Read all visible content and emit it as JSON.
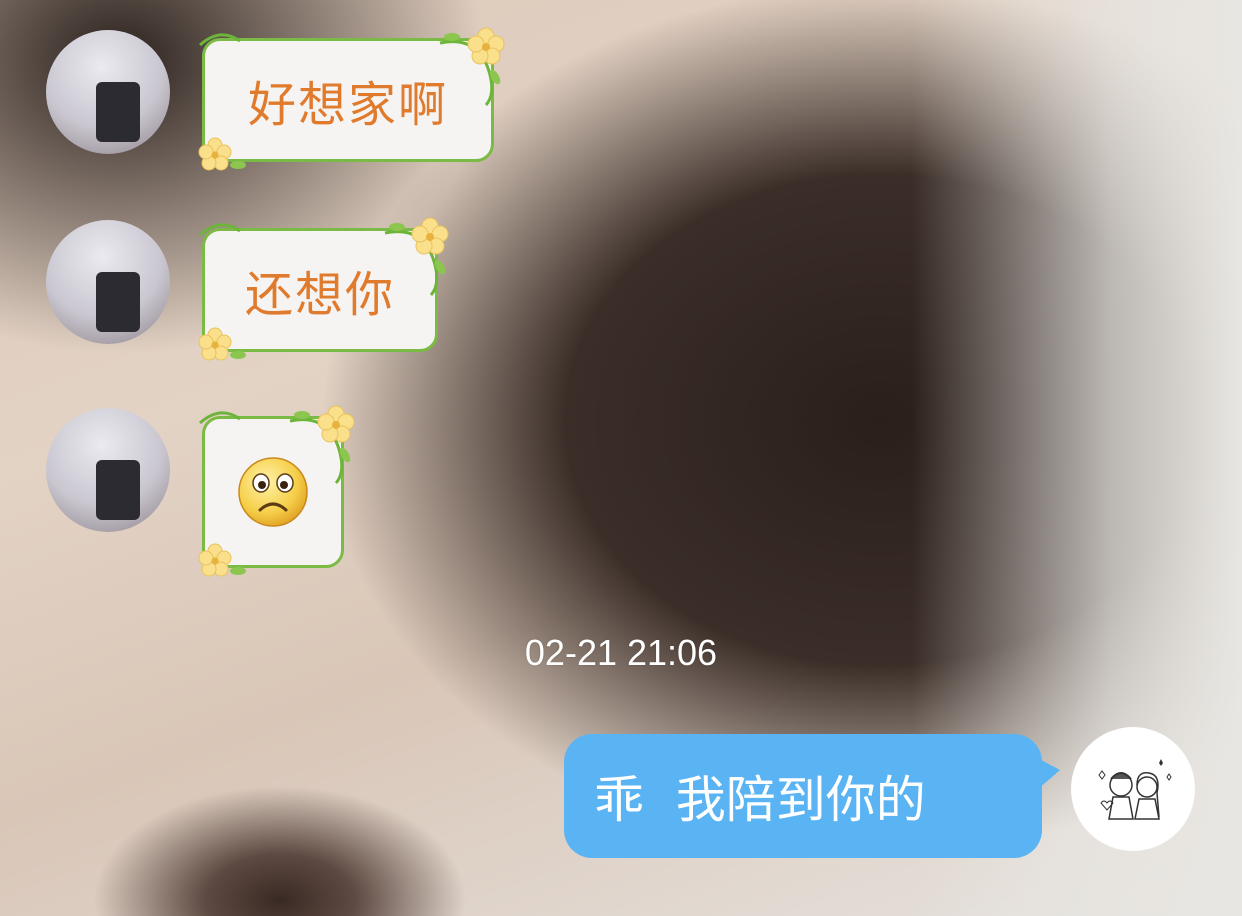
{
  "chat": {
    "messages": [
      {
        "direction": "incoming",
        "text": "好想家啊"
      },
      {
        "direction": "incoming",
        "text": "还想你"
      },
      {
        "direction": "incoming",
        "emoji": "sad-face-emoji"
      },
      {
        "timestamp": "02-21 21:06"
      },
      {
        "direction": "outgoing",
        "text": "乖  我陪到你的"
      }
    ]
  },
  "colors": {
    "incoming_border": "#7bbb45",
    "incoming_text": "#e07a2c",
    "outgoing_bubble": "#5ab3f3",
    "outgoing_text": "#ffffff",
    "timestamp_text": "#ffffff"
  },
  "icons": [
    "contact-avatar",
    "my-avatar",
    "flower-vine-decoration",
    "sad-face-emoji"
  ]
}
